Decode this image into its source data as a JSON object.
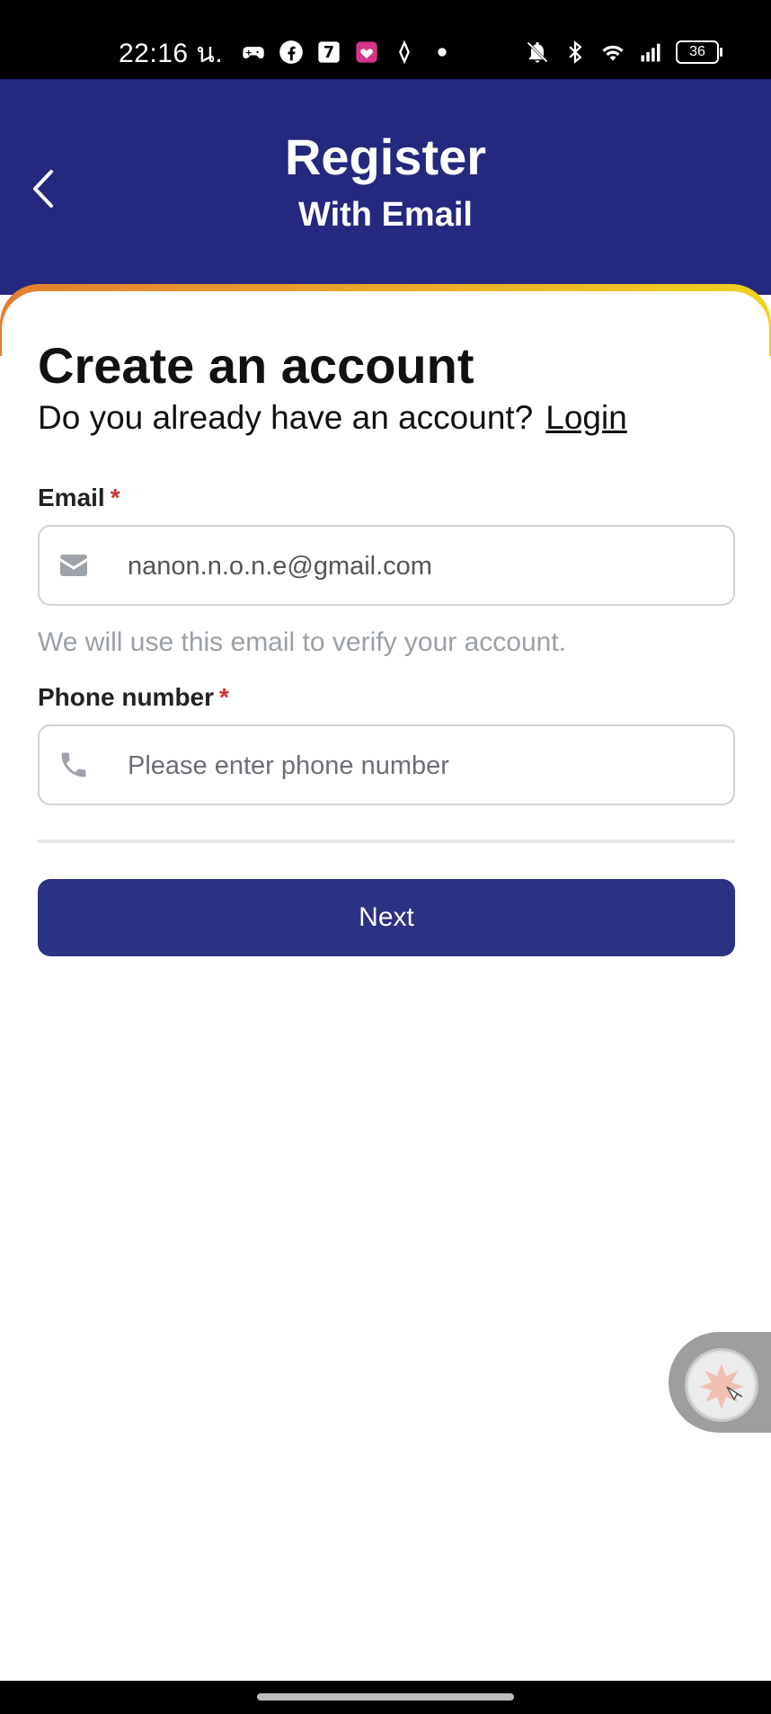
{
  "status_bar": {
    "time": "22:16 น.",
    "battery": "36",
    "icons": [
      "game-controller-icon",
      "facebook-icon",
      "seven-eleven-icon",
      "lineman-icon",
      "navigation-icon",
      "dot-icon",
      "bell-off-icon",
      "bluetooth-icon",
      "wifi-icon",
      "signal-icon",
      "battery-icon"
    ]
  },
  "header": {
    "title": "Register",
    "subtitle": "With Email",
    "back_icon": "chevron-left-icon"
  },
  "card": {
    "title": "Create an account",
    "login_prompt": "Do you already have an account?",
    "login_link": "Login"
  },
  "form": {
    "email": {
      "label": "Email",
      "required_mark": "*",
      "value": "nanon.n.o.n.e@gmail.com",
      "icon": "envelope-icon",
      "hint": "We will use this email to verify your account."
    },
    "phone": {
      "label": "Phone number",
      "required_mark": "*",
      "value": "",
      "placeholder": "Please enter phone number",
      "icon": "phone-icon"
    },
    "next_label": "Next"
  },
  "colors": {
    "header_bg": "#25287f",
    "button_bg": "#2b3183",
    "accent_start": "#e57d2f",
    "accent_end": "#f1d21f",
    "required": "#d32f2f"
  }
}
